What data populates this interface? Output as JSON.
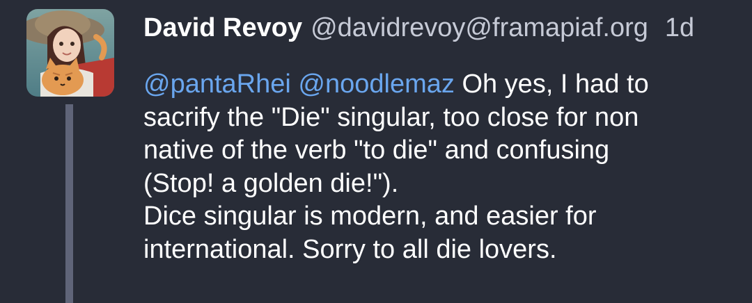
{
  "status": {
    "display_name": "David Revoy",
    "handle": "@davidrevoy@framapiaf.org",
    "timestamp": "1d",
    "mentions": [
      "@pantaRhei",
      "@noodlemaz"
    ],
    "paragraph1": {
      "line1_text": "Oh yes, I had to",
      "line2": "sacrify the \"Die\" singular, too close for non",
      "line3": "native of the verb \"to die\" and confusing",
      "line4": "(Stop! a golden die!\")."
    },
    "paragraph2": {
      "line1": "Dice singular is modern, and easier for",
      "line2": "international. Sorry to all die lovers."
    }
  },
  "colors": {
    "background": "#282c37",
    "mention": "#6aa6ee",
    "secondary_text": "#c6cad6",
    "thread_line": "#5f6478"
  },
  "icons": {
    "avatar": "avatar-illustration-girl-with-cat"
  }
}
